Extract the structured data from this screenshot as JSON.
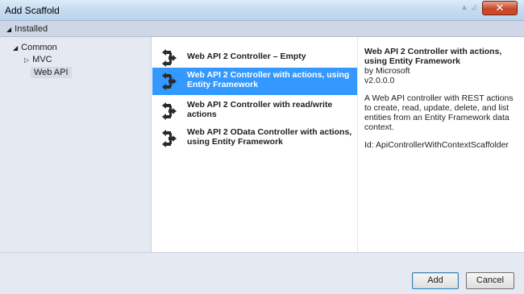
{
  "window": {
    "title": "Add Scaffold",
    "close_glyph": "✕"
  },
  "header": {
    "installed_label": "Installed"
  },
  "tree": {
    "common": "Common",
    "mvc": "MVC",
    "web_api": "Web API"
  },
  "templates": [
    {
      "label": "Web API 2 Controller – Empty",
      "icon": "controller-icon",
      "selected": false
    },
    {
      "label": "Web API 2 Controller with actions, using Entity Framework",
      "icon": "controller-icon",
      "selected": true
    },
    {
      "label": "Web API 2 Controller with read/write actions",
      "icon": "controller-icon",
      "selected": false
    },
    {
      "label": "Web API 2 OData Controller with actions, using Entity Framework",
      "icon": "controller-icon",
      "selected": false
    }
  ],
  "details": {
    "title": "Web API 2 Controller with actions, using Entity Framework",
    "author": "by Microsoft",
    "version": "v2.0.0.0",
    "description": "A Web API controller with REST actions to create, read, update, delete, and list entities from an Entity Framework data context.",
    "id_line": "Id: ApiControllerWithContextScaffolder"
  },
  "buttons": {
    "add": "Add",
    "cancel": "Cancel"
  },
  "colors": {
    "selection": "#3399ff",
    "pane_background": "#e5e9f1",
    "header_background": "#cfd6e5"
  }
}
